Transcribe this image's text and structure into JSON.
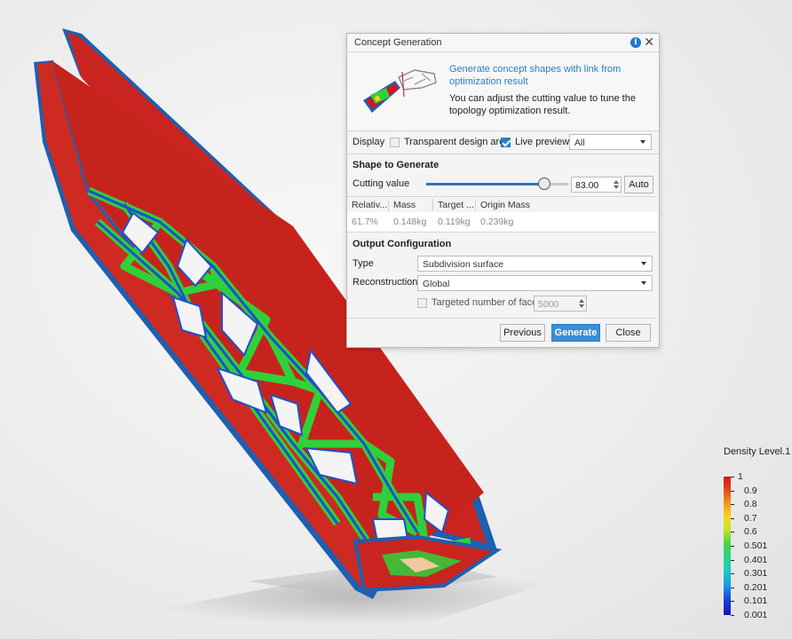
{
  "dialog": {
    "title": "Concept Generation",
    "intro_link": "Generate concept shapes with link from optimization result",
    "intro_desc": "You can adjust the cutting value to tune the topology optimization result.",
    "display": {
      "label": "Display",
      "transparent_label": "Transparent design area",
      "transparent_checked": false,
      "live_preview_label": "Live preview",
      "live_preview_checked": true,
      "filter_value": "All"
    },
    "shape": {
      "heading": "Shape to Generate",
      "cutting_label": "Cutting value",
      "cutting_value": "83.00",
      "cutting_fraction": 0.83,
      "auto_label": "Auto"
    },
    "table": {
      "headers": [
        "Relativ...",
        "Mass",
        "Target ...",
        "Origin Mass"
      ],
      "row": [
        "61.7%",
        "0.148kg",
        "0.119kg",
        "0.239kg"
      ]
    },
    "output": {
      "heading": "Output Configuration",
      "type_label": "Type",
      "type_value": "Subdivision surface",
      "recon_label": "Reconstruction",
      "recon_value": "Global",
      "faces_label": "Targeted number of faces",
      "faces_value": "5000"
    },
    "buttons": {
      "previous": "Previous",
      "generate": "Generate",
      "close": "Close"
    }
  },
  "legend": {
    "title": "Density Level.1",
    "ticks": [
      "1",
      "0.9",
      "0.8",
      "0.7",
      "0.6",
      "0.501",
      "0.401",
      "0.301",
      "0.201",
      "0.101",
      "0.001"
    ]
  },
  "colors": {
    "accent": "#2a7fc6",
    "primary_button": "#3a8ed3",
    "density_high": "#d4141c",
    "density_low": "#1414b4"
  }
}
